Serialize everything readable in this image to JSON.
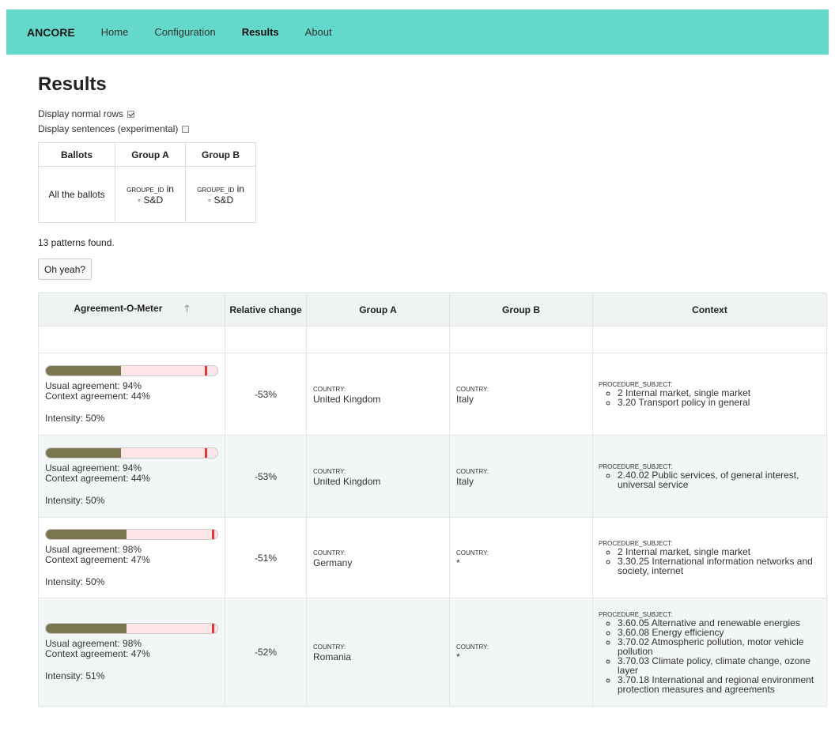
{
  "nav": {
    "brand": "ANCORE",
    "items": [
      "Home",
      "Configuration",
      "Results",
      "About"
    ],
    "active": "Results"
  },
  "page": {
    "title": "Results",
    "option_normal_rows": "Display normal rows",
    "option_normal_rows_checked": true,
    "option_sentences": "Display sentences (experimental)",
    "option_sentences_checked": false,
    "patterns_found": "13 patterns found.",
    "oh_yeah_button": "Oh yeah?"
  },
  "summary": {
    "headers": [
      "Ballots",
      "Group A",
      "Group B"
    ],
    "ballots": "All the ballots",
    "group_a_attr": "GROUPE_ID",
    "group_a_op": "in",
    "group_a_value": "S&D",
    "group_b_attr": "GROUPE_ID",
    "group_b_op": "in",
    "group_b_value": "S&D"
  },
  "results": {
    "headers": {
      "meter": "Agreement-O-Meter",
      "relative_change": "Relative change",
      "group_a": "Group A",
      "group_b": "Group B",
      "context": "Context"
    },
    "rows": [
      {
        "usual": "Usual agreement: 94%",
        "context": "Context agreement: 44%",
        "intensity": "Intensity: 50%",
        "usual_value": 0.94,
        "context_value": 0.44,
        "relative_change": "-53%",
        "group_a_label": "COUNTRY:",
        "group_a_value": "United Kingdom",
        "group_b_label": "COUNTRY:",
        "group_b_value": "Italy",
        "context_label": "PROCEDURE_SUBJECT:",
        "context_items": [
          "2 Internal market, single market",
          "3.20 Transport policy in general"
        ]
      },
      {
        "usual": "Usual agreement: 94%",
        "context": "Context agreement: 44%",
        "intensity": "Intensity: 50%",
        "usual_value": 0.94,
        "context_value": 0.44,
        "relative_change": "-53%",
        "group_a_label": "COUNTRY:",
        "group_a_value": "United Kingdom",
        "group_b_label": "COUNTRY:",
        "group_b_value": "Italy",
        "context_label": "PROCEDURE_SUBJECT:",
        "context_items": [
          "2.40.02 Public services, of general interest, universal service"
        ]
      },
      {
        "usual": "Usual agreement: 98%",
        "context": "Context agreement: 47%",
        "intensity": "Intensity: 50%",
        "usual_value": 0.98,
        "context_value": 0.47,
        "relative_change": "-51%",
        "group_a_label": "COUNTRY:",
        "group_a_value": "Germany",
        "group_b_label": "COUNTRY:",
        "group_b_value": "*",
        "context_label": "PROCEDURE_SUBJECT:",
        "context_items": [
          "2 Internal market, single market",
          "3.30.25 International information networks and society, internet"
        ]
      },
      {
        "usual": "Usual agreement: 98%",
        "context": "Context agreement: 47%",
        "intensity": "Intensity: 51%",
        "usual_value": 0.98,
        "context_value": 0.47,
        "relative_change": "-52%",
        "group_a_label": "COUNTRY:",
        "group_a_value": "Romania",
        "group_b_label": "COUNTRY:",
        "group_b_value": "*",
        "context_label": "PROCEDURE_SUBJECT:",
        "context_items": [
          "3.60.05 Alternative and renewable energies",
          "3.60.08 Energy efficiency",
          "3.70.02 Atmospheric pollution, motor vehicle pollution",
          "3.70.03 Climate policy, climate change, ozone layer",
          "3.70.18 International and regional environment protection measures and agreements"
        ]
      }
    ]
  },
  "colors": {
    "navbar": "#64d8cb",
    "meter_fill": "#7b7650",
    "meter_track": "#fde4e6",
    "meter_mark": "#d93a3a"
  }
}
